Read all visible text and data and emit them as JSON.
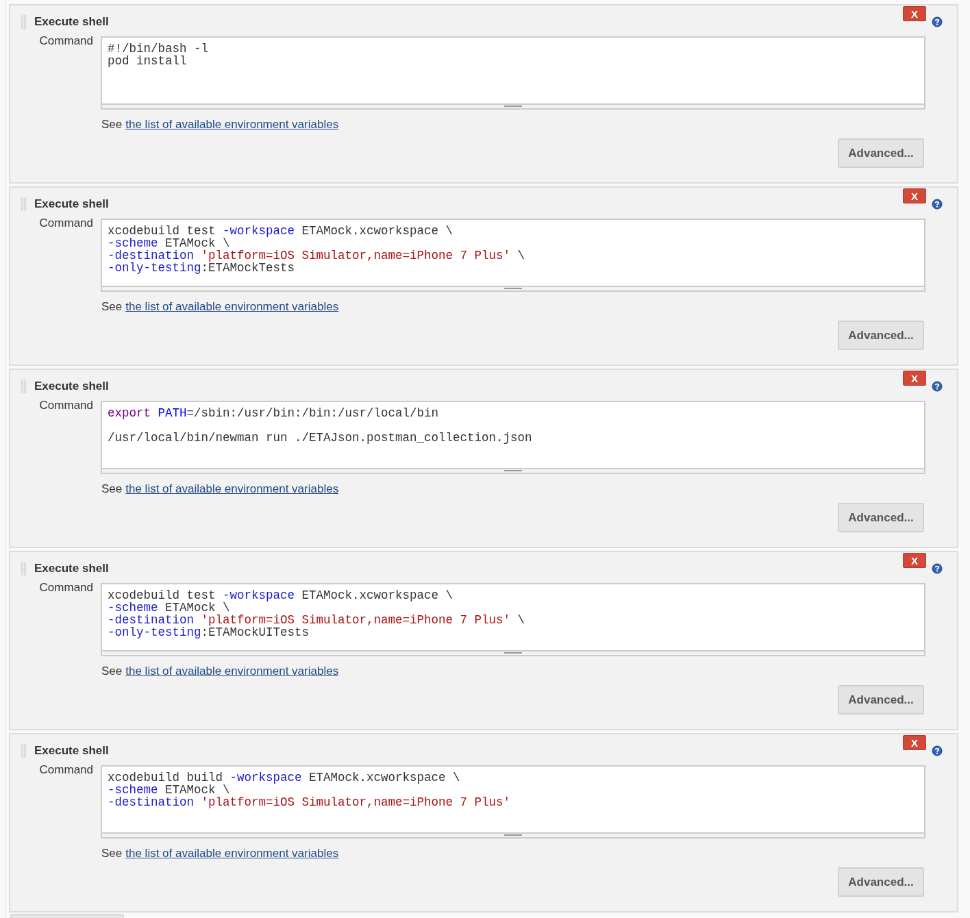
{
  "builders": [
    {
      "title": "Execute shell",
      "delete_button": "X",
      "field_label": "Command",
      "code_lines": [
        {
          "tokens": [
            {
              "kind": "plain",
              "text": "#!/bin/bash -l"
            }
          ]
        },
        {
          "tokens": [
            {
              "kind": "plain",
              "text": "pod install"
            }
          ]
        }
      ],
      "hint": "See",
      "link": "the list of available environment variables",
      "advanced_button": "Advanced..."
    },
    {
      "title": "Execute shell",
      "delete_button": "X",
      "field_label": "Command",
      "code_lines": [
        {
          "tokens": [
            {
              "kind": "plain",
              "text": "xcodebuild test "
            },
            {
              "kind": "flag",
              "text": "-workspace"
            },
            {
              "kind": "plain",
              "text": " ETAMock.xcworkspace \\"
            }
          ]
        },
        {
          "tokens": [
            {
              "kind": "flag",
              "text": "-scheme"
            },
            {
              "kind": "plain",
              "text": " ETAMock \\"
            }
          ]
        },
        {
          "tokens": [
            {
              "kind": "flag",
              "text": "-destination "
            },
            {
              "kind": "string",
              "text": "'platform=iOS Simulator,name=iPhone 7 Plus'"
            },
            {
              "kind": "plain",
              "text": " \\"
            }
          ]
        },
        {
          "tokens": [
            {
              "kind": "flag",
              "text": "-only-testing"
            },
            {
              "kind": "plain",
              "text": ":ETAMockTests"
            }
          ]
        }
      ],
      "hint": "See",
      "link": "the list of available environment variables",
      "advanced_button": "Advanced..."
    },
    {
      "title": "Execute shell",
      "delete_button": "X",
      "field_label": "Command",
      "code_lines": [
        {
          "tokens": [
            {
              "kind": "keyword",
              "text": "export "
            },
            {
              "kind": "variable",
              "text": "PATH"
            },
            {
              "kind": "plain",
              "text": "=/sbin:/usr/bin:/bin:/usr/local/bin"
            }
          ]
        },
        {
          "gap_before": true,
          "tokens": [
            {
              "kind": "plain",
              "text": "/usr/local/bin/newman run ./ETAJson.postman_collection.json"
            }
          ]
        }
      ],
      "hint": "See",
      "link": "the list of available environment variables",
      "advanced_button": "Advanced..."
    },
    {
      "title": "Execute shell",
      "delete_button": "X",
      "field_label": "Command",
      "code_lines": [
        {
          "tokens": [
            {
              "kind": "plain",
              "text": "xcodebuild test "
            },
            {
              "kind": "flag",
              "text": "-workspace"
            },
            {
              "kind": "plain",
              "text": " ETAMock.xcworkspace \\"
            }
          ]
        },
        {
          "tokens": [
            {
              "kind": "flag",
              "text": "-scheme"
            },
            {
              "kind": "plain",
              "text": " ETAMock \\"
            }
          ]
        },
        {
          "tokens": [
            {
              "kind": "flag",
              "text": "-destination "
            },
            {
              "kind": "string",
              "text": "'platform=iOS Simulator,name=iPhone 7 Plus'"
            },
            {
              "kind": "plain",
              "text": " \\"
            }
          ]
        },
        {
          "tokens": [
            {
              "kind": "flag",
              "text": "-only-testing"
            },
            {
              "kind": "plain",
              "text": ":ETAMockUITests"
            }
          ]
        }
      ],
      "hint": "See",
      "link": "the list of available environment variables",
      "advanced_button": "Advanced..."
    },
    {
      "title": "Execute shell",
      "delete_button": "X",
      "field_label": "Command",
      "code_lines": [
        {
          "tokens": [
            {
              "kind": "plain",
              "text": "xcodebuild build "
            },
            {
              "kind": "flag",
              "text": "-workspace"
            },
            {
              "kind": "plain",
              "text": " ETAMock.xcworkspace \\"
            }
          ]
        },
        {
          "tokens": [
            {
              "kind": "flag",
              "text": "-scheme"
            },
            {
              "kind": "plain",
              "text": " ETAMock \\"
            }
          ]
        },
        {
          "tokens": [
            {
              "kind": "flag",
              "text": "-destination "
            },
            {
              "kind": "string",
              "text": "'platform=iOS Simulator,name=iPhone 7 Plus'"
            }
          ]
        }
      ],
      "hint": "See",
      "link": "the list of available environment variables",
      "advanced_button": "Advanced..."
    }
  ]
}
